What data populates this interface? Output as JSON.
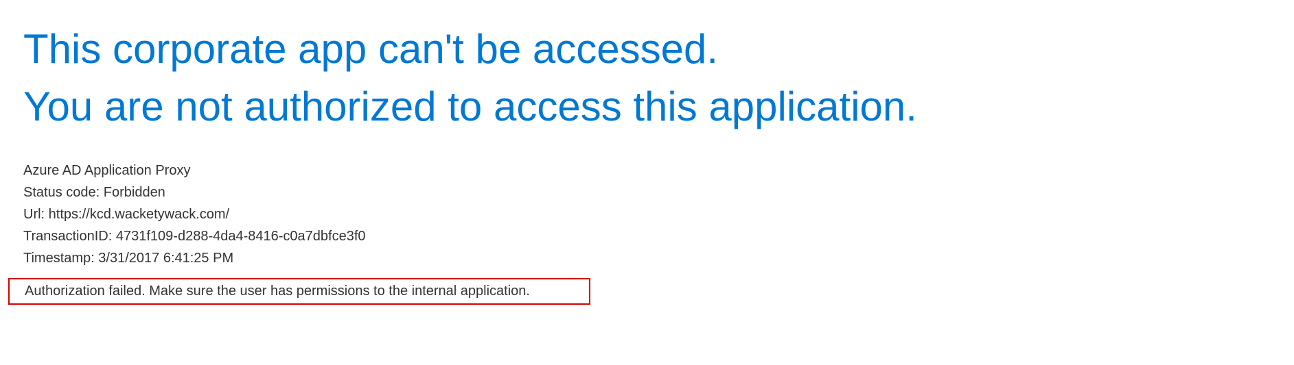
{
  "heading_line1": "This corporate app can't be accessed.",
  "heading_line2": "You are not authorized to access this application.",
  "details": {
    "service": "Azure AD Application Proxy",
    "status_label": "Status code:",
    "status_value": "Forbidden",
    "url_label": "Url:",
    "url_value": "https://kcd.wacketywack.com/",
    "transaction_label": "TransactionID:",
    "transaction_value": "4731f109-d288-4da4-8416-c0a7dbfce3f0",
    "timestamp_label": "Timestamp:",
    "timestamp_value": "3/31/2017 6:41:25 PM"
  },
  "error_message": "Authorization failed. Make sure the user has permissions to the internal application."
}
